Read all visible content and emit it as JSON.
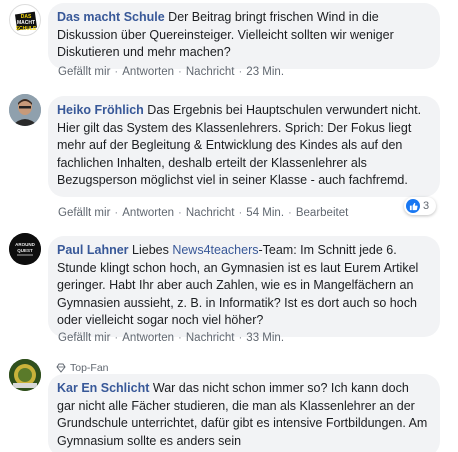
{
  "comments": [
    {
      "author": "Das macht Schule",
      "text": " Der Beitrag bringt frischen Wind in die Diskussion über Quereinsteiger. Vielleicht sollten wir weniger Diskutieren und mehr machen?",
      "actions": {
        "like": "Gefällt mir",
        "reply": "Antworten",
        "message": "Nachricht",
        "time": "23 Min."
      },
      "avatar_text": [
        "DAS",
        "MACHT",
        "SCHULE"
      ]
    },
    {
      "author": "Heiko Fröhlich",
      "text": " Das Ergebnis bei Hauptschulen verwundert nicht. Hier gilt das System des Klassenlehrers. Sprich: Der Fokus liegt mehr auf der Begleitung & Entwicklung des Kindes als auf den fachlichen Inhalten, deshalb erteilt der Klassenlehrer als Bezugsperson möglichst viel in seiner Klasse - auch fachfremd.",
      "actions": {
        "like": "Gefällt mir",
        "reply": "Antworten",
        "message": "Nachricht",
        "time": "54 Min.",
        "edited": "Bearbeitet"
      },
      "reaction_count": "3"
    },
    {
      "author": "Paul Lahner",
      "text_before": " Liebes ",
      "mention": "News4teachers",
      "text_after": "-Team: Im Schnitt jede 6. Stunde klingt schon hoch, an Gymnasien ist es laut Eurem Artikel geringer. Habt Ihr aber auch Zahlen, wie es in Mangelfächern an Gymnasien aussieht, z. B. in Informatik? Ist es dort auch so hoch oder vielleicht sogar noch viel höher?",
      "actions": {
        "like": "Gefällt mir",
        "reply": "Antworten",
        "message": "Nachricht",
        "time": "33 Min."
      },
      "avatar_text": [
        "AROUND",
        "QUEST"
      ]
    },
    {
      "badge": "Top-Fan",
      "author": "Kar En Schlicht",
      "text": " War das nicht schon immer so? Ich kann doch gar nicht alle Fächer studieren, die man als Klassenlehrer an der Grundschule unterrichtet, dafür gibt es intensive Fortbildungen. Am Gymnasium sollte es anders sein"
    }
  ],
  "colors": {
    "link": "#385898",
    "bubble": "#f2f3f5",
    "meta": "#606770",
    "like": "#1877f2"
  },
  "icons": [
    "like-reaction-icon",
    "top-fan-diamond-icon"
  ]
}
